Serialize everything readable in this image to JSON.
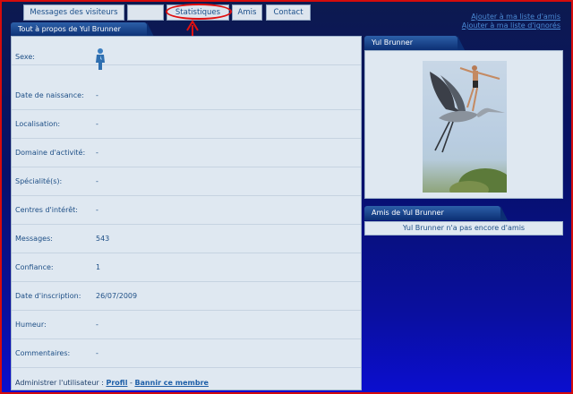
{
  "tabs": [
    "Messages des visiteurs",
    "",
    "Statistiques",
    "Amis",
    "Contact"
  ],
  "top_links": [
    "Ajouter à ma liste d'amis",
    "Ajouter à ma liste d'ignorés"
  ],
  "profile_panel": {
    "title": "Tout à propos de Yul Brunner",
    "rows": [
      {
        "label": "Sexe:",
        "value": ""
      },
      {
        "label": "Date de naissance:",
        "value": "-"
      },
      {
        "label": "Localisation:",
        "value": "-"
      },
      {
        "label": "Domaine d'activité:",
        "value": "-"
      },
      {
        "label": "Spécialité(s):",
        "value": "-"
      },
      {
        "label": "Centres d'intérêt:",
        "value": "-"
      },
      {
        "label": "Messages:",
        "value": "543"
      },
      {
        "label": "Confiance:",
        "value": "1"
      },
      {
        "label": "Date d'inscription:",
        "value": "26/07/2009"
      },
      {
        "label": "Humeur:",
        "value": "-"
      },
      {
        "label": "Commentaires:",
        "value": "-"
      }
    ],
    "admin_label": "Administrer l'utilisateur :",
    "admin_profile_link": "Profil",
    "admin_separator": "-",
    "admin_ban_link": "Bannir ce membre"
  },
  "avatar_panel": {
    "title": "Yul Brunner"
  },
  "friends_panel": {
    "title": "Amis de Yul Brunner",
    "empty_text": "Yul Brunner n'a pas encore d'amis"
  },
  "colors": {
    "highlight": "#e01010",
    "link": "#4a8ad4"
  },
  "icons": {
    "gender": "male-gender-icon"
  }
}
